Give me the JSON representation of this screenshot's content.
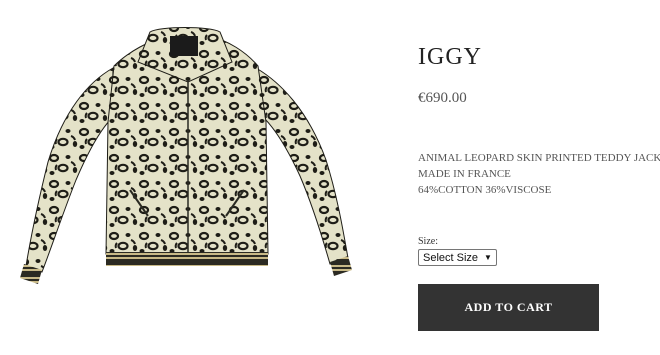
{
  "product": {
    "title": "IGGY",
    "price": "€690.00",
    "image_alt": "leopard-print-teddy-jacket",
    "description": [
      "ANIMAL LEOPARD SKIN PRINTED TEDDY JACKET",
      "MADE IN FRANCE",
      "64%COTTON 36%VISCOSE"
    ]
  },
  "size": {
    "label": "Size:",
    "selected": "Select Size",
    "icon": "chevron-down-icon"
  },
  "cart": {
    "button_label": "ADD TO CART"
  },
  "colors": {
    "button_bg": "#333333",
    "button_text": "#ffffff",
    "price_text": "#555555"
  }
}
